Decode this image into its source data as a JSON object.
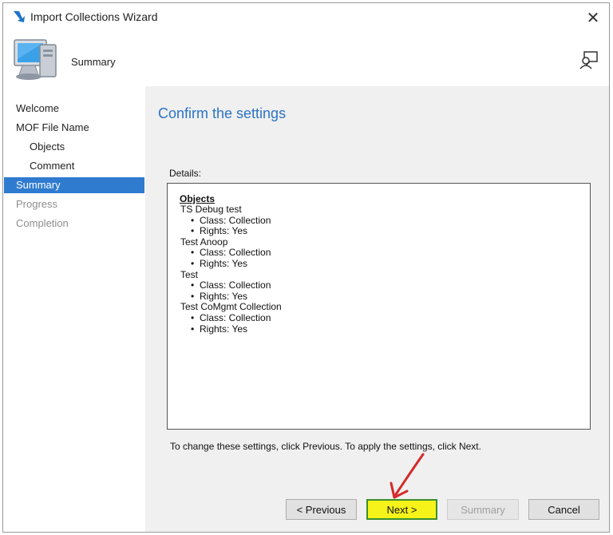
{
  "window": {
    "title": "Import Collections Wizard",
    "close_glyph": "✕"
  },
  "header": {
    "title": "Summary"
  },
  "sidebar": {
    "items": [
      {
        "label": "Welcome",
        "state": "done"
      },
      {
        "label": "MOF File Name",
        "state": "done"
      },
      {
        "label": "Objects",
        "state": "done"
      },
      {
        "label": "Comment",
        "state": "done"
      },
      {
        "label": "Summary",
        "state": "active"
      },
      {
        "label": "Progress",
        "state": "disabled"
      },
      {
        "label": "Completion",
        "state": "disabled"
      }
    ]
  },
  "main": {
    "title": "Confirm the settings",
    "details_label": "Details:",
    "details": {
      "heading": "Objects",
      "objects": [
        {
          "name": "TS Debug test",
          "props": [
            "Class: Collection",
            "Rights: Yes"
          ]
        },
        {
          "name": "Test Anoop",
          "props": [
            "Class: Collection",
            "Rights: Yes"
          ]
        },
        {
          "name": "Test",
          "props": [
            "Class: Collection",
            "Rights: Yes"
          ]
        },
        {
          "name": "Test CoMgmt Collection",
          "props": [
            "Class: Collection",
            "Rights: Yes"
          ]
        }
      ]
    },
    "footer_note": "To change these settings, click Previous. To apply the settings, click Next."
  },
  "buttons": {
    "previous": "< Previous",
    "next": "Next >",
    "summary": "Summary",
    "cancel": "Cancel"
  },
  "colors": {
    "accent": "#2f7bd0",
    "title_blue": "#2b73c4",
    "highlight": "#f5f31a",
    "annotation_arrow": "#d42a2a"
  }
}
